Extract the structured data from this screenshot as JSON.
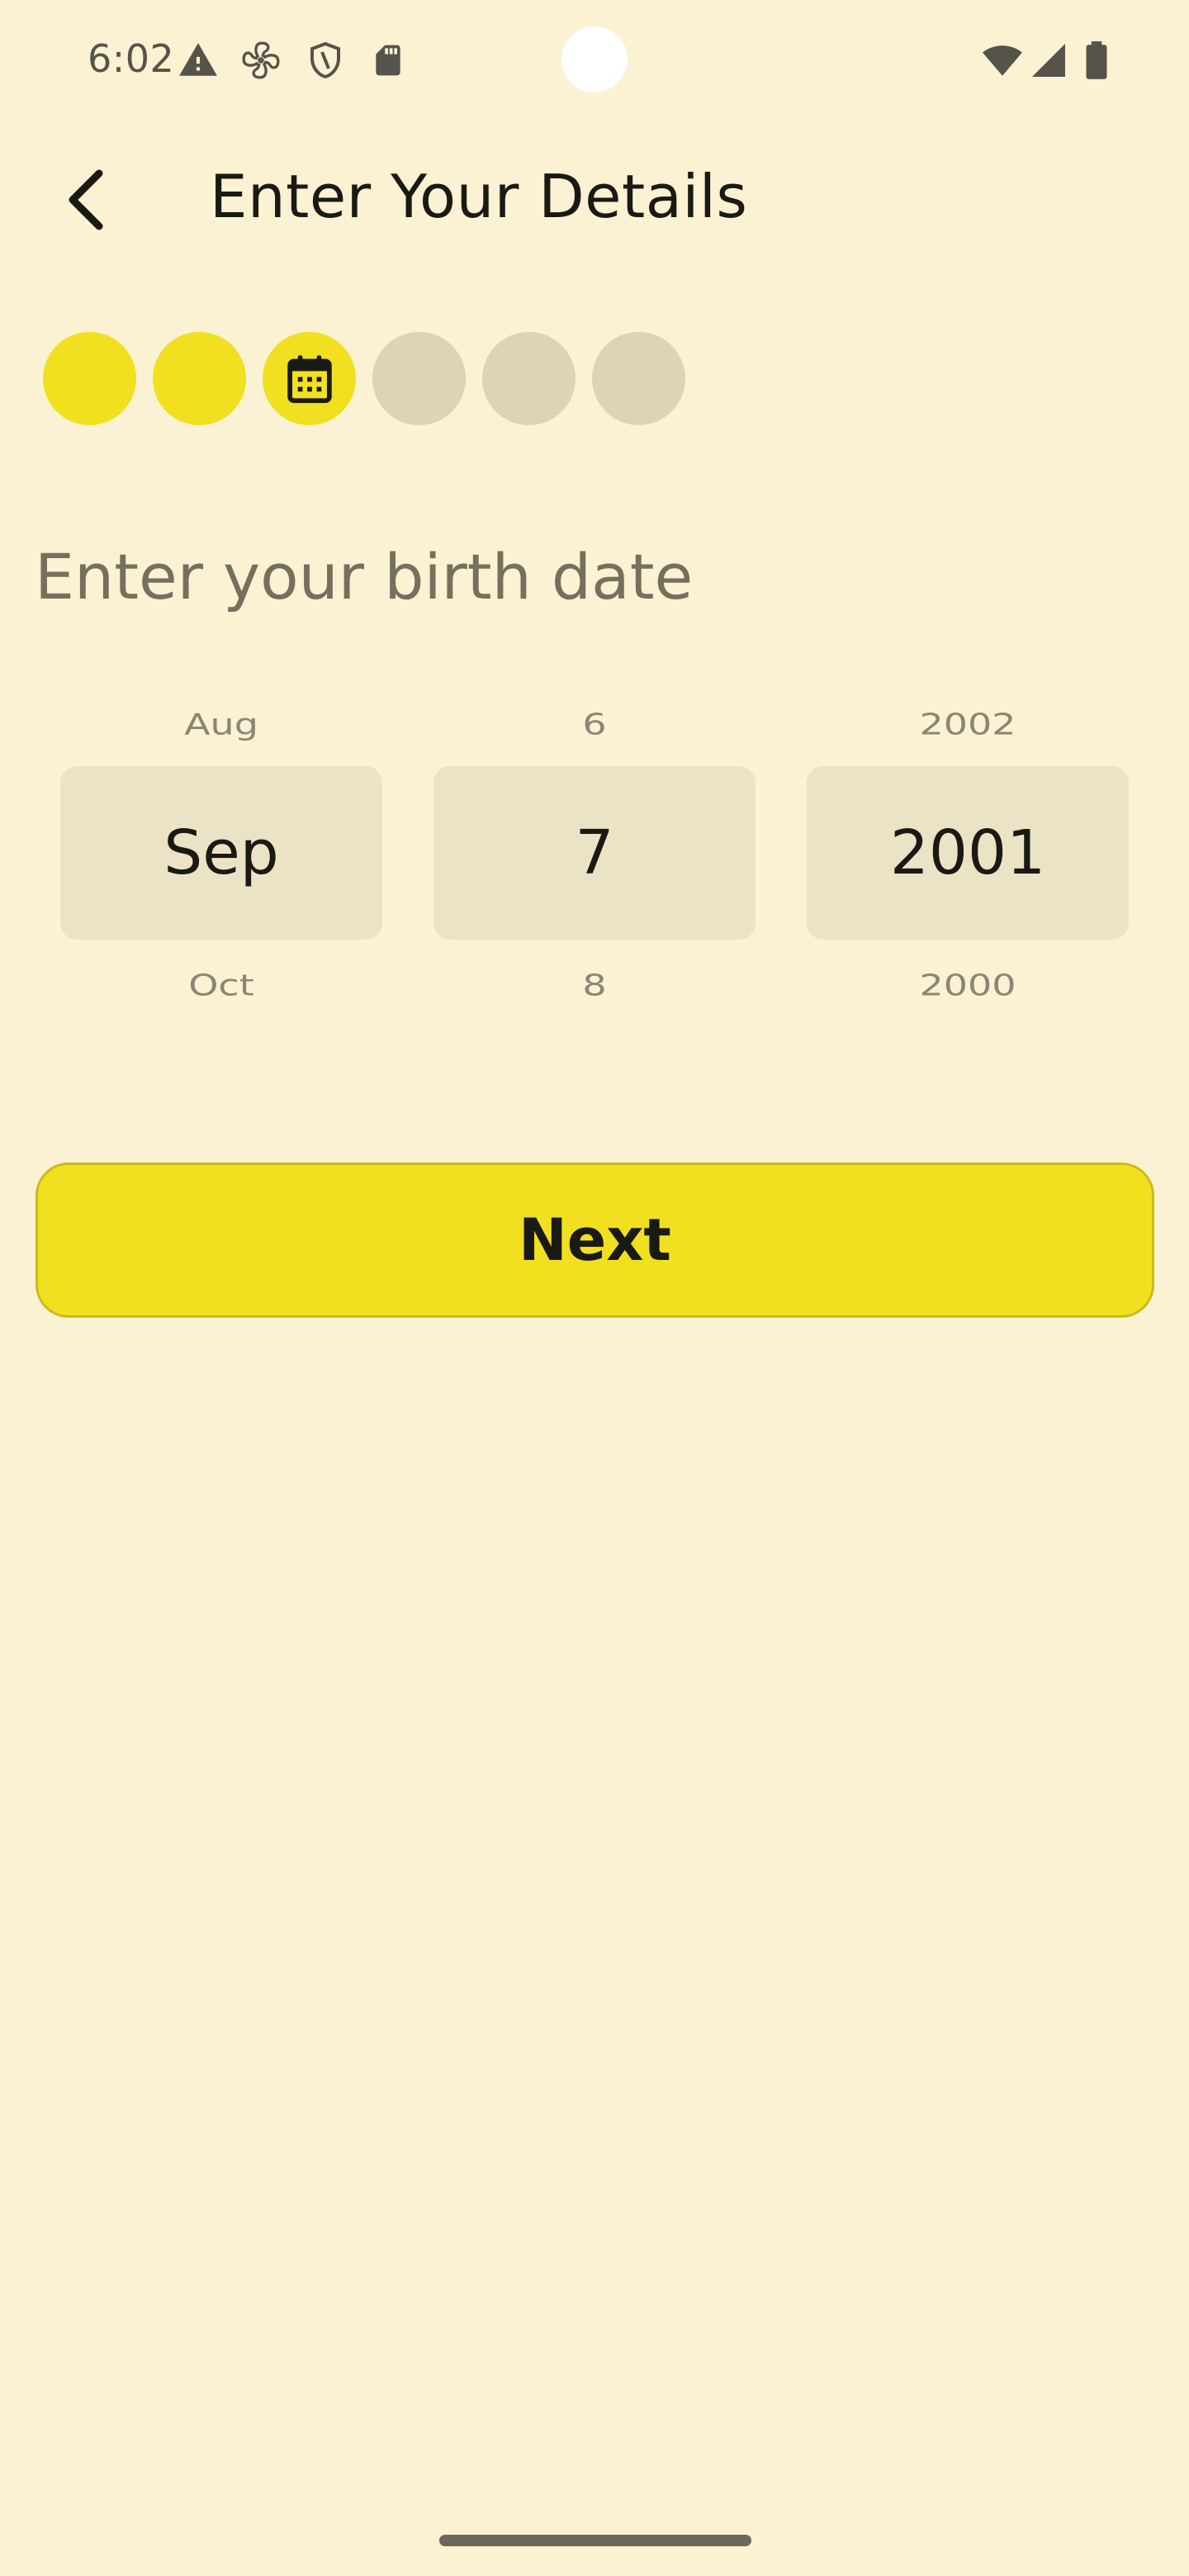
{
  "status_bar": {
    "time": "6:02",
    "icons_left": [
      "warning-icon",
      "fan-icon",
      "shield-icon",
      "sd-card-icon"
    ],
    "icons_right": [
      "wifi-icon",
      "signal-icon",
      "battery-icon"
    ]
  },
  "app_bar": {
    "back_icon": "arrow-back-icon",
    "title": "Enter Your Details"
  },
  "steps": {
    "total": 6,
    "states": [
      "done",
      "done",
      "current",
      "todo",
      "todo",
      "todo"
    ],
    "current_icon": "calendar-icon",
    "colors": {
      "active": "#F0E020",
      "inactive": "#DDD4B5"
    }
  },
  "form": {
    "heading": "Enter your birth date",
    "month": {
      "prev": "Aug",
      "current": "Sep",
      "next": "Oct"
    },
    "day": {
      "prev": "6",
      "current": "7",
      "next": "8"
    },
    "year": {
      "prev": "2002",
      "current": "2001",
      "next": "2000"
    }
  },
  "actions": {
    "next_label": "Next"
  },
  "colors": {
    "background": "#FBF2D3",
    "accent": "#F0E020",
    "picker_bg": "#EBE3C6"
  }
}
